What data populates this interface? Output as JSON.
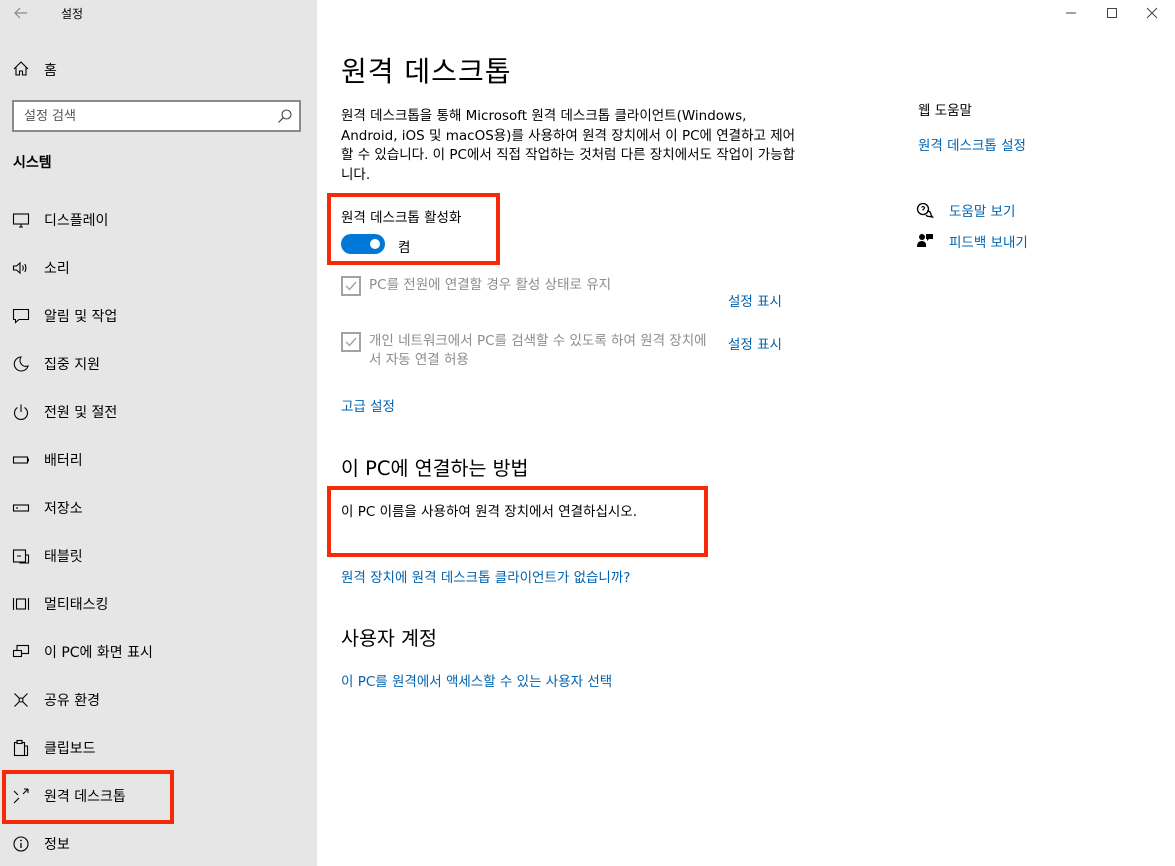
{
  "window": {
    "app_title": "설정",
    "minimize_glyph": "—",
    "maximize_glyph": "☐",
    "close_glyph": "✕"
  },
  "sidebar": {
    "home_label": "홈",
    "search_placeholder": "설정 검색",
    "section_title": "시스템",
    "items": [
      {
        "label": "디스플레이",
        "icon": "display-icon"
      },
      {
        "label": "소리",
        "icon": "sound-icon"
      },
      {
        "label": "알림 및 작업",
        "icon": "notifications-icon"
      },
      {
        "label": "집중 지원",
        "icon": "focus-assist-icon"
      },
      {
        "label": "전원 및 절전",
        "icon": "power-icon"
      },
      {
        "label": "배터리",
        "icon": "battery-icon"
      },
      {
        "label": "저장소",
        "icon": "storage-icon"
      },
      {
        "label": "태블릿",
        "icon": "tablet-icon"
      },
      {
        "label": "멀티태스킹",
        "icon": "multitasking-icon"
      },
      {
        "label": "이 PC에 화면 표시",
        "icon": "projecting-icon"
      },
      {
        "label": "공유 환경",
        "icon": "shared-experiences-icon"
      },
      {
        "label": "클립보드",
        "icon": "clipboard-icon"
      },
      {
        "label": "원격 데스크톱",
        "icon": "remote-desktop-icon",
        "selected": true
      },
      {
        "label": "정보",
        "icon": "info-icon"
      }
    ]
  },
  "main": {
    "title": "원격 데스크톱",
    "description": "원격 데스크톱을 통해 Microsoft 원격 데스크톱 클라이언트(Windows, Android, iOS 및 macOS용)를 사용하여 원격 장치에서 이 PC에 연결하고 제어할 수 있습니다. 이 PC에서 직접 작업하는 것처럼 다른 장치에서도 작업이 가능합니다.",
    "toggle_label": "원격 데스크톱 활성화",
    "toggle_state": "켬",
    "toggle_on": true,
    "checkbox1_text": "PC를 전원에 연결할 경우 활성 상태로 유지",
    "checkbox1_checked": true,
    "checkbox1_link": "설정 표시",
    "checkbox2_text": "개인 네트워크에서 PC를 검색할 수 있도록 하여 원격 장치에서 자동 연결 허용",
    "checkbox2_checked": true,
    "checkbox2_link": "설정 표시",
    "advanced_link": "고급 설정",
    "connect_heading": "이 PC에 연결하는 방법",
    "connect_text": "이 PC 이름을 사용하여 원격 장치에서 연결하십시오.",
    "client_link": "원격 장치에 원격 데스크톱 클라이언트가 없습니까?",
    "accounts_heading": "사용자 계정",
    "accounts_link": "이 PC를 원격에서 액세스할 수 있는 사용자 선택"
  },
  "help": {
    "web_help_title": "웹 도움말",
    "web_help_link": "원격 데스크톱 설정",
    "get_help": "도움말 보기",
    "feedback": "피드백 보내기"
  },
  "colors": {
    "accent": "#0078d7",
    "link": "#0063b1",
    "highlight": "#f52a0a",
    "sidebar_bg": "#e6e6e6"
  }
}
